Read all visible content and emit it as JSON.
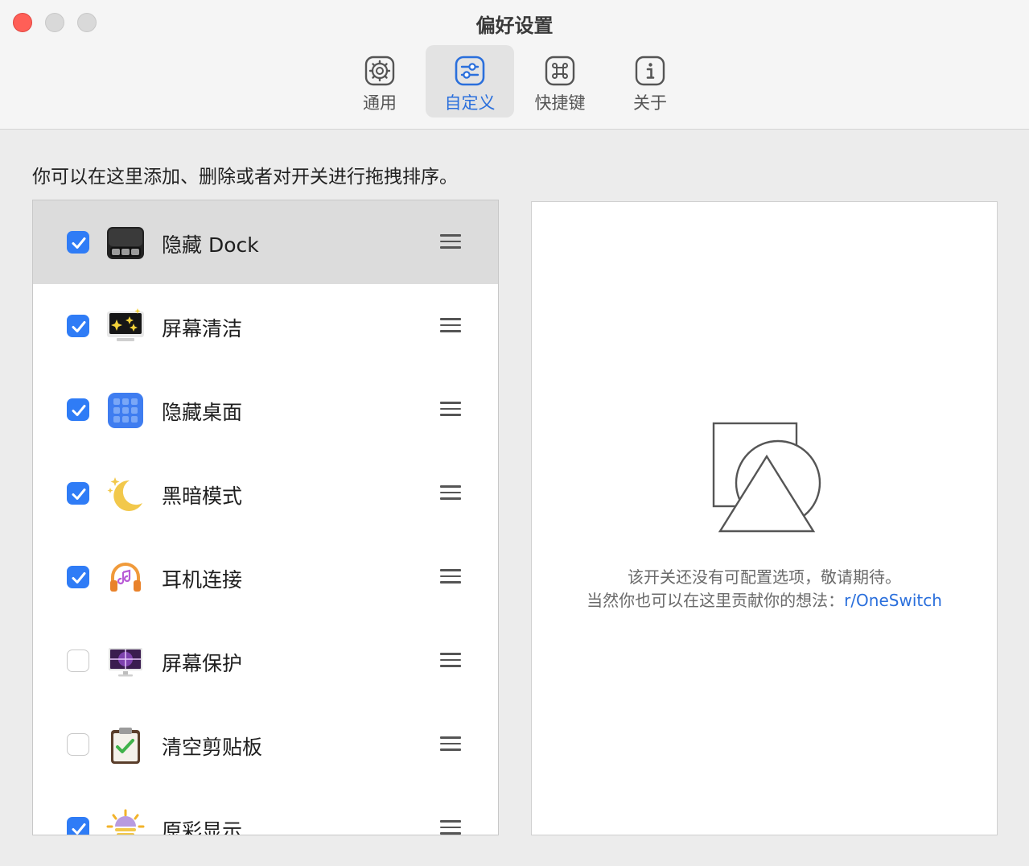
{
  "window": {
    "title": "偏好设置"
  },
  "tabs": [
    {
      "label": "通用",
      "icon": "gear-icon"
    },
    {
      "label": "自定义",
      "icon": "sliders-icon",
      "active": true
    },
    {
      "label": "快捷键",
      "icon": "command-icon"
    },
    {
      "label": "关于",
      "icon": "info-icon"
    }
  ],
  "instruction": "你可以在这里添加、删除或者对开关进行拖拽排序。",
  "switches": [
    {
      "label": "隐藏 Dock",
      "checked": true,
      "icon": "dock-icon",
      "selected": true
    },
    {
      "label": "屏幕清洁",
      "checked": true,
      "icon": "screen-clean-icon"
    },
    {
      "label": "隐藏桌面",
      "checked": true,
      "icon": "desktop-grid-icon"
    },
    {
      "label": "黑暗模式",
      "checked": true,
      "icon": "moon-icon"
    },
    {
      "label": "耳机连接",
      "checked": true,
      "icon": "headphones-icon"
    },
    {
      "label": "屏幕保护",
      "checked": false,
      "icon": "screensaver-icon"
    },
    {
      "label": "清空剪贴板",
      "checked": false,
      "icon": "clipboard-icon"
    },
    {
      "label": "原彩显示",
      "checked": true,
      "icon": "true-tone-icon"
    }
  ],
  "detail": {
    "message_line1": "该开关还没有可配置选项，敬请期待。",
    "message_line2_prefix": "当然你也可以在这里贡献你的想法：",
    "link_text": "r/OneSwitch"
  },
  "colors": {
    "accent": "#2f7cf6",
    "link": "#2a6fdc",
    "close": "#ff5f57"
  }
}
